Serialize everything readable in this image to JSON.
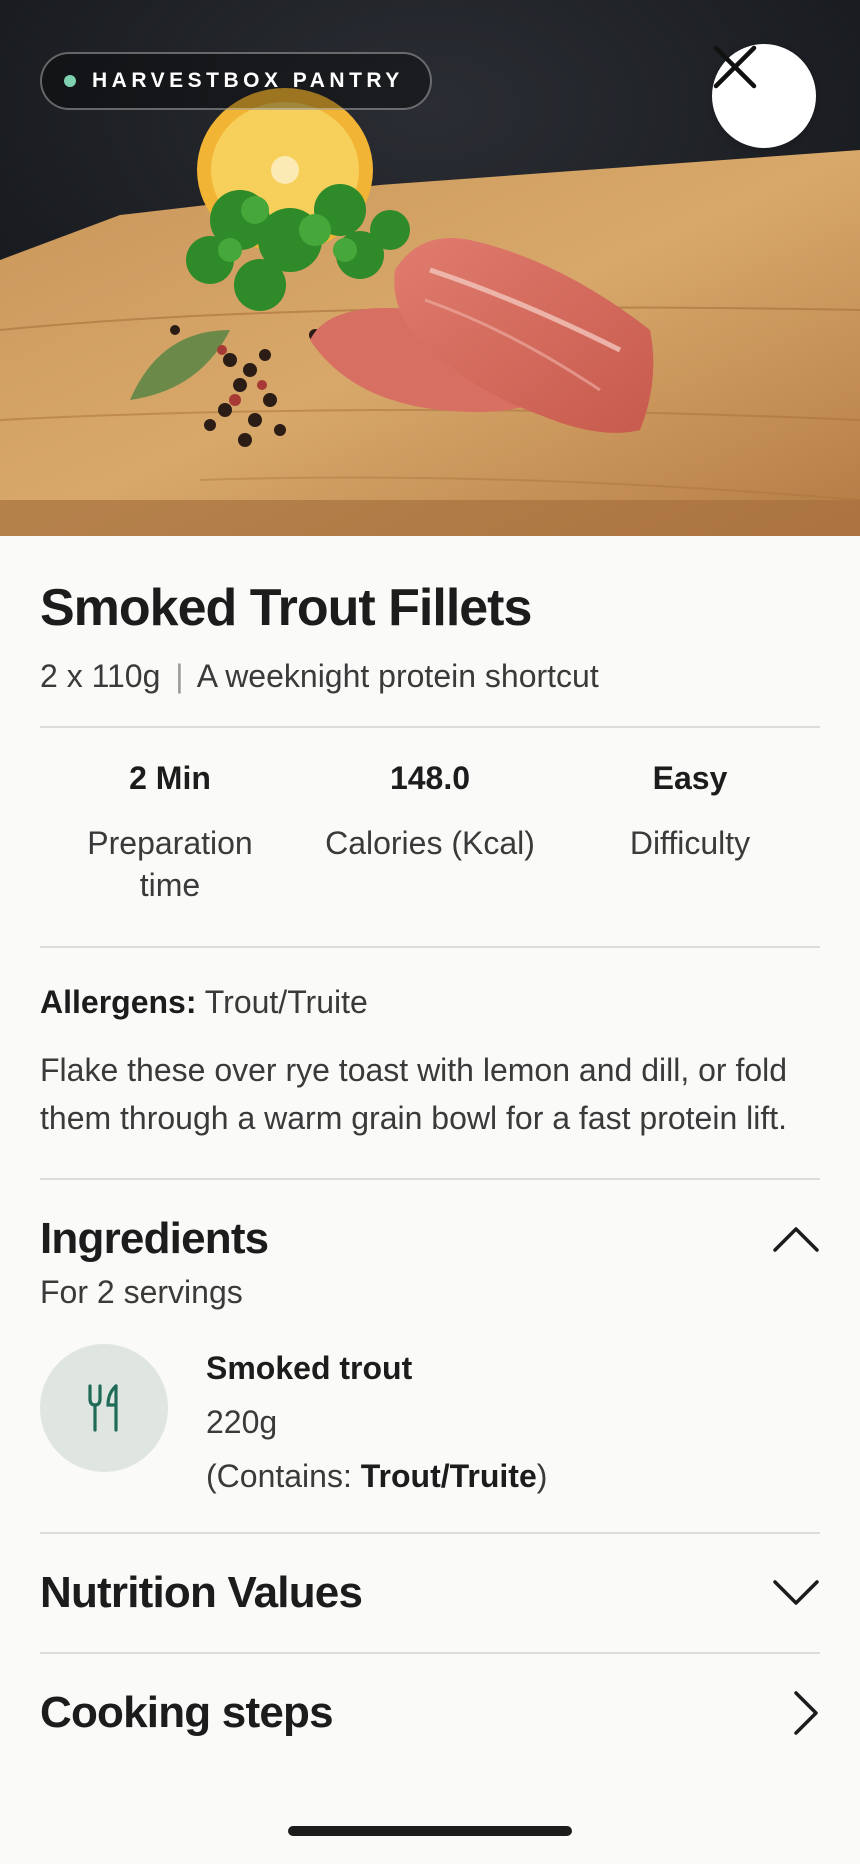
{
  "hero": {
    "brand": "HARVESTBOX PANTRY",
    "close_icon": "close-icon",
    "image_description_icon": "food-photo"
  },
  "product": {
    "title": "Smoked Trout Fillets",
    "portion": "2 x 110g",
    "separator": "|",
    "tagline": "A weeknight protein shortcut"
  },
  "stats": [
    {
      "value": "2 Min",
      "label": "Preparation time"
    },
    {
      "value": "148.0",
      "label": "Calories (Kcal)"
    },
    {
      "value": "Easy",
      "label": "Difficulty"
    }
  ],
  "allergens": {
    "label": "Allergens:",
    "value": "Trout/Truite"
  },
  "description": "Flake these over rye toast with lemon and dill, or fold them through a warm grain bowl for a fast protein lift.",
  "ingredients": {
    "title": "Ingredients",
    "servings": "For 2 servings",
    "items": [
      {
        "icon": "cutlery-icon",
        "name": "Smoked trout",
        "quantity": "220g",
        "contains_prefix": "(Contains: ",
        "contains_value": "Trout/Truite",
        "contains_suffix": ")"
      }
    ]
  },
  "nutrition": {
    "title": "Nutrition Values"
  },
  "cooking": {
    "title": "Cooking steps"
  },
  "colors": {
    "accent": "#1f6b57",
    "brand_dot": "#7fd1b0",
    "icon_bg": "#dfe6e1"
  }
}
